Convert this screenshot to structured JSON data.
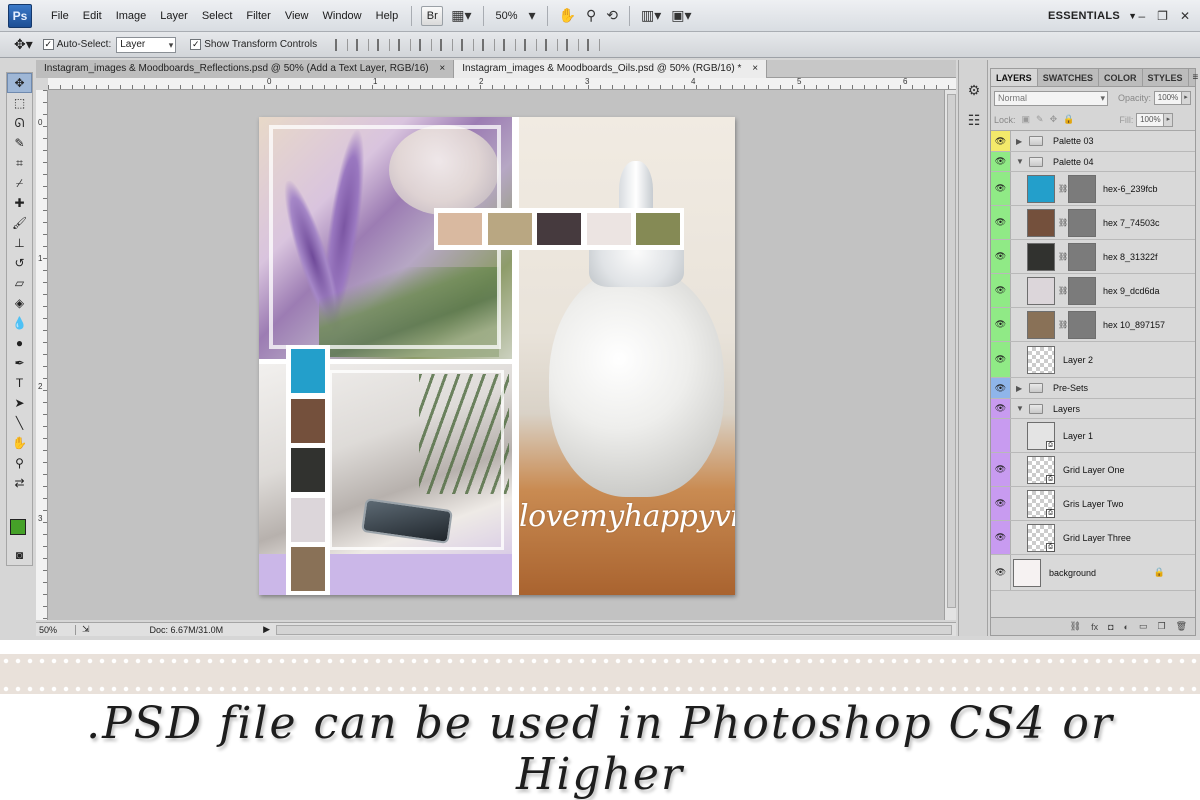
{
  "app": {
    "logo": "Ps",
    "menu": [
      "File",
      "Edit",
      "Image",
      "Layer",
      "Select",
      "Filter",
      "View",
      "Window",
      "Help"
    ],
    "bridge_button": "Br",
    "zoom": "50%",
    "workspace": "ESSENTIALS",
    "icons": [
      "bridge-icon",
      "mini-bridge-icon",
      "hand-icon",
      "zoom-icon",
      "rotate-icon",
      "arrange-icon",
      "screen-mode-icon"
    ]
  },
  "options_bar": {
    "auto_select_label": "Auto-Select:",
    "auto_select_checked": true,
    "auto_select_value": "Layer",
    "show_transform_label": "Show Transform Controls",
    "show_transform_checked": true
  },
  "tabs": [
    {
      "label": "Instagram_images & Moodboards_Reflections.psd @ 50% (Add a Text Layer, RGB/16)",
      "active": false
    },
    {
      "label": "Instagram_images & Moodboards_Oils.psd @ 50% (RGB/16) *",
      "active": true
    }
  ],
  "status": {
    "zoom": "50%",
    "doc": "Doc: 6.67M/31.0M"
  },
  "rulers": {
    "top": [
      "0",
      "1",
      "2",
      "3",
      "4",
      "5",
      "6",
      "7"
    ],
    "left": [
      "0",
      "1",
      "2",
      "3"
    ]
  },
  "canvas": {
    "watermark": "lovemyhappyvibes",
    "palette_swatches": [
      "#d9b9a0",
      "#b9a782",
      "#463a3e",
      "#ece4e2",
      "#858a55"
    ],
    "column_swatches": [
      "#239fcb",
      "#74503c",
      "#31322f",
      "#dcd6da",
      "#897157"
    ]
  },
  "panel": {
    "tabs": [
      "LAYERS",
      "SWATCHES",
      "COLOR",
      "STYLES"
    ],
    "blend_mode": "Normal",
    "opacity_label": "Opacity:",
    "opacity": "100%",
    "lock_label": "Lock:",
    "fill_label": "Fill:",
    "fill": "100%",
    "layers": [
      {
        "name": "Palette 03",
        "type": "group",
        "collapsed": true,
        "color": "#f3e96a"
      },
      {
        "name": "Palette 04",
        "type": "group",
        "collapsed": false,
        "color": "#90ea86"
      },
      {
        "name": "hex-6_239fcb",
        "type": "fill",
        "swatch": "#239fcb",
        "color": "#90ea86"
      },
      {
        "name": "hex 7_74503c",
        "type": "fill",
        "swatch": "#74503c",
        "color": "#90ea86"
      },
      {
        "name": "hex 8_31322f",
        "type": "fill",
        "swatch": "#31322f",
        "color": "#90ea86"
      },
      {
        "name": "hex 9_dcd6da",
        "type": "fill",
        "swatch": "#dcd6da",
        "color": "#90ea86"
      },
      {
        "name": "hex 10_897157",
        "type": "fill",
        "swatch": "#897157",
        "color": "#90ea86"
      },
      {
        "name": "Layer 2",
        "type": "layer",
        "color": "#90ea86"
      },
      {
        "name": "Pre-Sets",
        "type": "group",
        "collapsed": true,
        "color": "#8fb5ea"
      },
      {
        "name": "Layers",
        "type": "group",
        "collapsed": false,
        "color": "#c89bf0"
      },
      {
        "name": "Layer 1",
        "type": "smart",
        "color": "#c89bf0",
        "hidden": true
      },
      {
        "name": "Grid Layer One",
        "type": "smart",
        "color": "#c89bf0"
      },
      {
        "name": "Gris Layer Two",
        "type": "smart",
        "color": "#c89bf0"
      },
      {
        "name": "Grid Layer Three",
        "type": "smart",
        "color": "#c89bf0"
      },
      {
        "name": "background",
        "type": "background",
        "color": "#d9d9d9"
      }
    ]
  },
  "banner": {
    "text": ".PSD file can be used in Photoshop CS4 or Higher"
  }
}
